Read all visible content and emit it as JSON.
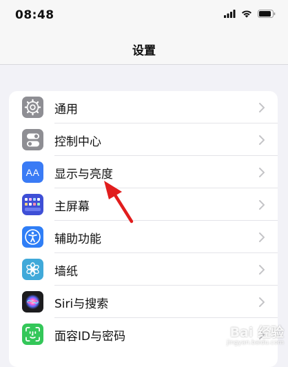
{
  "status_bar": {
    "time": "08:48",
    "icons": [
      "signal-icon",
      "wifi-icon",
      "battery-icon"
    ]
  },
  "nav": {
    "title": "设置"
  },
  "settings": {
    "items": [
      {
        "label": "通用",
        "icon": "gear-icon",
        "icon_bg": "#8e8e93"
      },
      {
        "label": "控制中心",
        "icon": "toggle-switches-icon",
        "icon_bg": "#8e8e93"
      },
      {
        "label": "显示与亮度",
        "icon": "text-size-icon",
        "icon_text": "AA",
        "icon_bg": "#3a7bf5"
      },
      {
        "label": "主屏幕",
        "icon": "home-screen-grid-icon",
        "icon_bg": "#3e4fd6"
      },
      {
        "label": "辅助功能",
        "icon": "accessibility-icon",
        "icon_bg": "#2f7ef6"
      },
      {
        "label": "墙纸",
        "icon": "flower-icon",
        "icon_bg": "#40a9d9"
      },
      {
        "label": "Siri与搜索",
        "icon": "siri-icon",
        "icon_bg": "#1c1c1e"
      },
      {
        "label": "面容ID与密码",
        "icon": "face-id-icon",
        "icon_bg": "#34c759"
      }
    ]
  },
  "annotation": {
    "arrow_color": "#e11d1d"
  },
  "watermark": {
    "main": "Bai 经验",
    "sub": "jingyan.baidu.com"
  }
}
